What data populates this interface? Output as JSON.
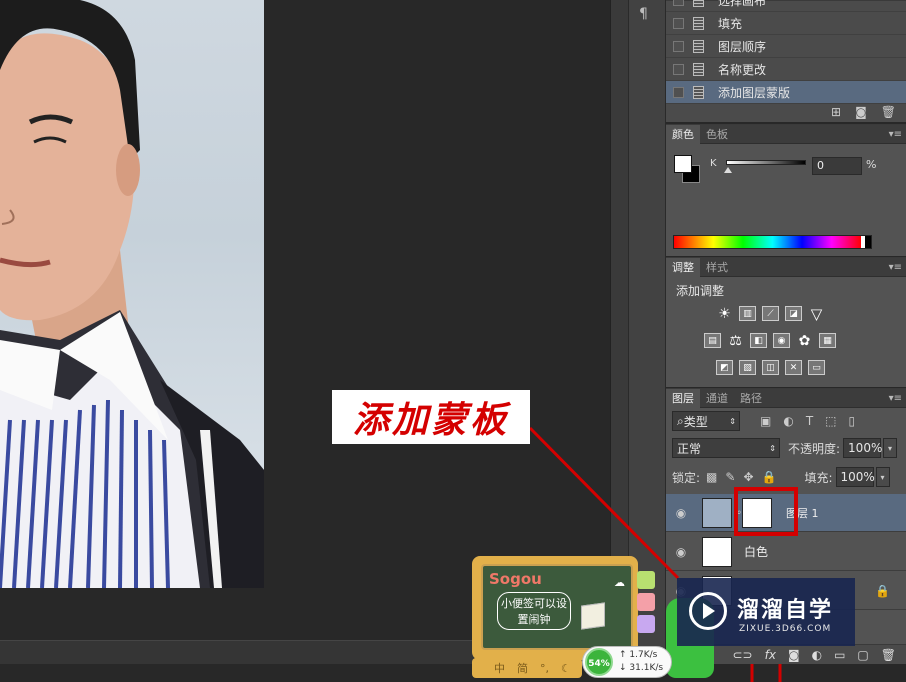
{
  "canvas": {
    "photo": "portrait-photo"
  },
  "actions_panel": {
    "items": [
      {
        "label": "选择画布",
        "selected": false
      },
      {
        "label": "填充",
        "selected": false
      },
      {
        "label": "图层顺序",
        "selected": false
      },
      {
        "label": "名称更改",
        "selected": false
      },
      {
        "label": "添加图层蒙版",
        "selected": true
      }
    ]
  },
  "color_panel": {
    "tabs": [
      "颜色",
      "色板"
    ],
    "channel_label": "K",
    "value": "0",
    "unit": "%"
  },
  "adjustments_panel": {
    "tabs": [
      "调整",
      "样式"
    ],
    "title": "添加调整"
  },
  "layers_panel": {
    "tabs": [
      "图层",
      "通道",
      "路径"
    ],
    "filter_kind": "类型",
    "blend_mode": "正常",
    "opacity_label": "不透明度:",
    "opacity_value": "100%",
    "lock_label": "锁定:",
    "fill_label": "填充:",
    "fill_value": "100%",
    "layers": [
      {
        "name": "图层 1",
        "selected": true
      },
      {
        "name": "白色",
        "selected": false
      }
    ],
    "footer_fx": "fx"
  },
  "annotation": {
    "text": "添加蒙板",
    "color": "#d40000"
  },
  "sogou_widget": {
    "logo": "Sogou",
    "note": "小便签可以设置闹钟",
    "bottom_labels": [
      "中",
      "简"
    ]
  },
  "net_monitor": {
    "percent": "54%",
    "upload": "1.7K/s",
    "download": "31.1K/s"
  },
  "watermark": {
    "title": "溜溜自学",
    "url": "ZIXUE.3D66.COM"
  }
}
